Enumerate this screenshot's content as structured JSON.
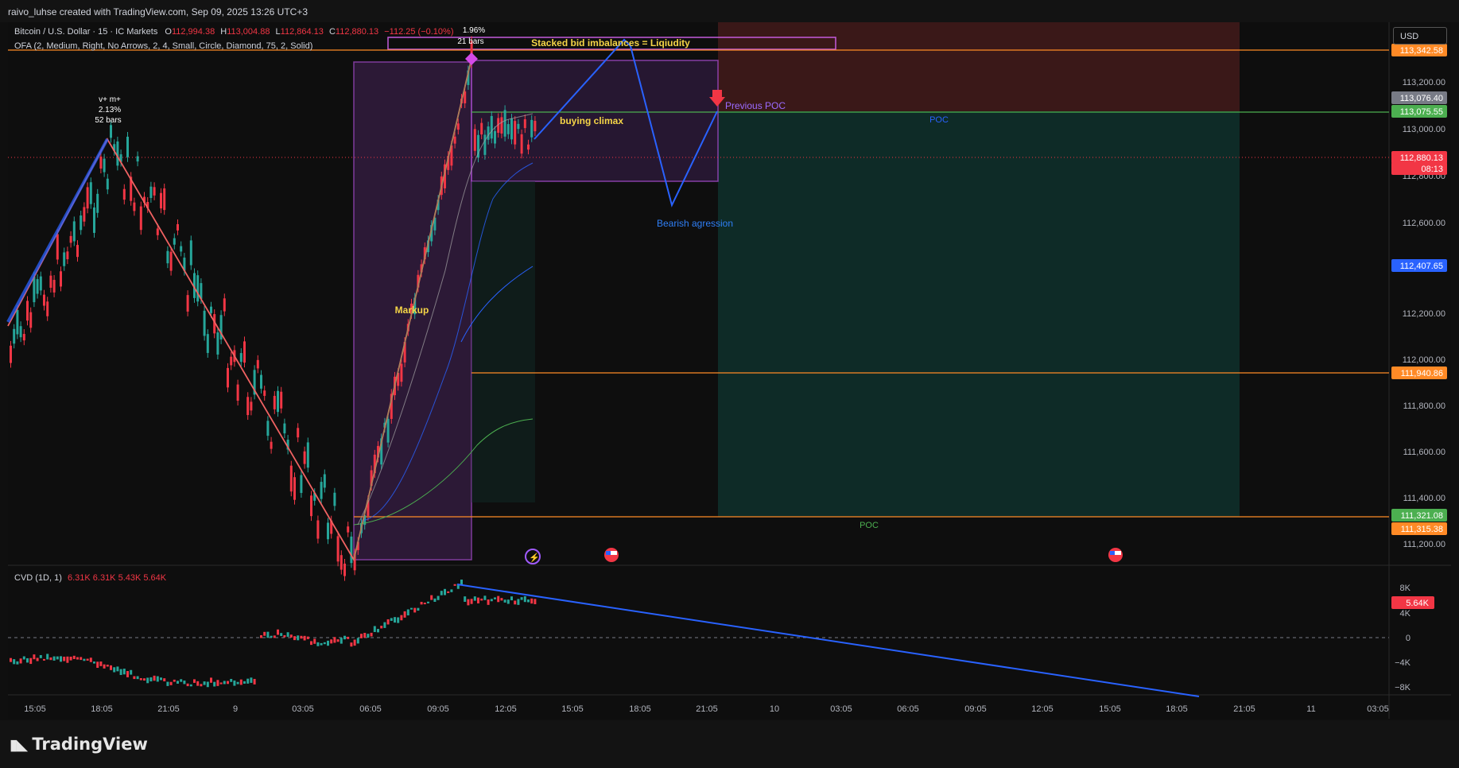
{
  "header": {
    "created_by": "raivo_luhse created with TradingView.com, Sep 09, 2025 13:26 UTC+3"
  },
  "legend": {
    "symbol": "Bitcoin / U.S. Dollar · 15 · IC Markets",
    "o_label": "O",
    "o_value": "112,994.38",
    "h_label": "H",
    "h_value": "113,004.88",
    "l_label": "L",
    "l_value": "112,864.13",
    "c_label": "C",
    "c_value": "112,880.13",
    "change": "−112.25 (−0.10%)",
    "ofa": "OFA (2, Medium, Right, No Arrows, 2, 4, Small, Circle, Diamond, 75, 2, Solid)",
    "cvd_label": "CVD (1D, 1)",
    "cvd_values": "6.31K  6.31K  5.43K  5.64K"
  },
  "currency_button": "USD",
  "price_axis": {
    "ticks": [
      "113,200.00",
      "113,000.00",
      "112,800.00",
      "112,600.00",
      "112,200.00",
      "112,000.00",
      "111,800.00",
      "111,600.00",
      "111,400.00",
      "111,200.00"
    ],
    "tags": [
      {
        "text": "113,342.58",
        "color": "#ff8a26"
      },
      {
        "text": "113,076.40",
        "color": "#787b86"
      },
      {
        "text": "113,075.55",
        "color": "#4caf50"
      },
      {
        "text": "112,880.13",
        "color": "#f23645"
      },
      {
        "text": "08:13",
        "color": "#f23645"
      },
      {
        "text": "112,407.65",
        "color": "#2962ff"
      },
      {
        "text": "111,940.86",
        "color": "#ff8a26"
      },
      {
        "text": "111,321.08",
        "color": "#4caf50"
      },
      {
        "text": "111,315.38",
        "color": "#ff8a26"
      }
    ]
  },
  "cvd_axis": {
    "ticks": [
      "8K",
      "4K",
      "0",
      "−4K",
      "−8K"
    ],
    "tag": "5.64K"
  },
  "time_axis": [
    "15:05",
    "18:05",
    "21:05",
    "9",
    "03:05",
    "06:05",
    "09:05",
    "12:05",
    "15:05",
    "18:05",
    "21:05",
    "10",
    "03:05",
    "06:05",
    "09:05",
    "12:05",
    "15:05",
    "18:05",
    "21:05",
    "11",
    "03:05"
  ],
  "annotations": {
    "swing_label_1": "v+ m+",
    "swing_label_2": "2.13%",
    "swing_label_3": "52 bars",
    "peak_label_1": "1.96%",
    "peak_label_2": "21 bars",
    "stacked_bid": "Stacked bid imbalances = Liqiudity",
    "buying_climax": "buying climax",
    "previous_poc": "Previous POC",
    "poc_upper": "POC",
    "poc_lower": "POC",
    "markup": "Markup",
    "bearish": "Bearish agression"
  },
  "brand": "TradingView",
  "colors": {
    "up": "#26a69a",
    "down": "#f23645",
    "orange": "#ff8a26",
    "blue": "#2962ff",
    "purple": "#9c27b0",
    "green_line": "#4caf50"
  }
}
